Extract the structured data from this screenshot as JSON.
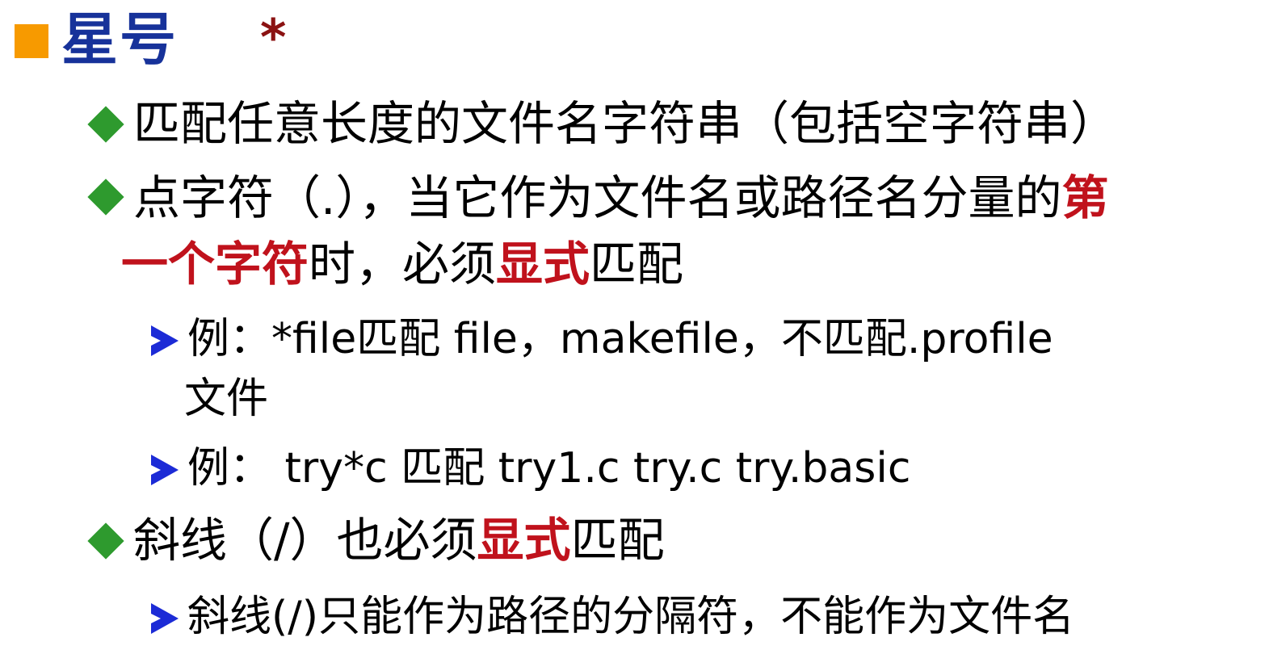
{
  "title": {
    "text": "星号",
    "symbol": "*"
  },
  "bullets": [
    {
      "text": "匹配任意长度的文件名字符串（包括空字符串）"
    },
    {
      "line1_part1": "点字符（.），当它作为文件名或路径名分量的",
      "line1_red": "第",
      "line2_red": "一个字符",
      "line2_part2": "时，必须",
      "line2_red2": "显式",
      "line2_part3": "匹配"
    }
  ],
  "examples": [
    {
      "line1": "例：*file匹配 file，makefile，不匹配.profile",
      "line2": "文件"
    },
    {
      "line1": "例：  try*c 匹配 try1.c try.c try.basic"
    }
  ],
  "slash": {
    "part1": "斜线（/）也必须",
    "red": "显式",
    "part2": "匹配",
    "sub": "斜线(/)只能作为路径的分隔符，不能作为文件名"
  },
  "colors": {
    "title": "#17329a",
    "title_bullet": "#f79a00",
    "star": "#8b1212",
    "diamond": "#2e9a2e",
    "arrow": "#1c2bd6",
    "emphasis": "#c0121c"
  }
}
